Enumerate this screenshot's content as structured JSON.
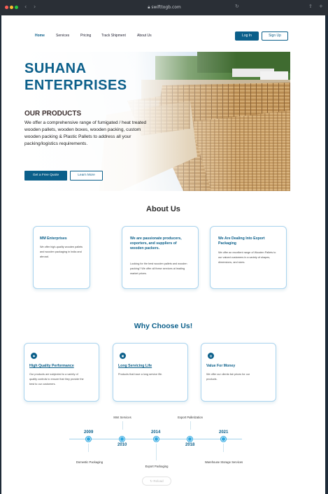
{
  "browser": {
    "url": "swifttogb.com",
    "colors": {
      "close": "#ff5f57",
      "minimize": "#febc2e",
      "maximize": "#28c840"
    }
  },
  "nav": {
    "links": [
      "Home",
      "Services",
      "Pricing",
      "Track Shipment",
      "About Us"
    ],
    "login": "Log In",
    "signup": "Sign Up"
  },
  "hero": {
    "title_line1": "SUHANA",
    "title_line2": "ENTERPRISES",
    "products_heading": "OUR PRODUCTS",
    "products_text": "We offer a comprehensive range of fumigated / heat treated wooden pallets, wooden boxes, wooden packing, custom wooden packing & Plastic Pallets to address all your packing/logistics requirements.",
    "quote_button": "Get a Free Quote",
    "learn_button": "Learn More"
  },
  "about": {
    "heading": "About Us",
    "cards": [
      {
        "title": "MM Enterprises",
        "text": "We offer high-quality wooden pallets and wooden packaging in India and abroad."
      },
      {
        "title": "We are passionate producers, exporters, and suppliers of wooden packers.",
        "text": "Looking for the best wooden pallets and wooden packing? We offer all these services at leading market prices."
      },
      {
        "title": "We Are Dealing Into Export Packaging",
        "text": "We offer an excellent range of Wooden Pallets to our valued customers in a variety of shapes, dimensions, and sizes."
      }
    ]
  },
  "why": {
    "heading": "Why Choose Us!",
    "cards": [
      {
        "icon": "shield-icon",
        "title": "High Quality Performance",
        "text": "Our products are subjected to a variety of quality controls to ensure that they provide the best to our customers."
      },
      {
        "icon": "box-icon",
        "title": "Long Servicing Life",
        "text": "Products that have a long service life."
      },
      {
        "icon": "tag-icon",
        "title": "Value For Money",
        "text": "We offer our clients fair prices for our products."
      }
    ]
  },
  "timeline": {
    "years": [
      "2009",
      "2010",
      "2014",
      "2018",
      "2021"
    ],
    "top_labels": [
      "Mmt Services",
      "Export Palletization"
    ],
    "bottom_labels": [
      "Domestic Packaging",
      "Export Packaging",
      "Warehouse Storage Services"
    ]
  },
  "reload_label": "Reload"
}
